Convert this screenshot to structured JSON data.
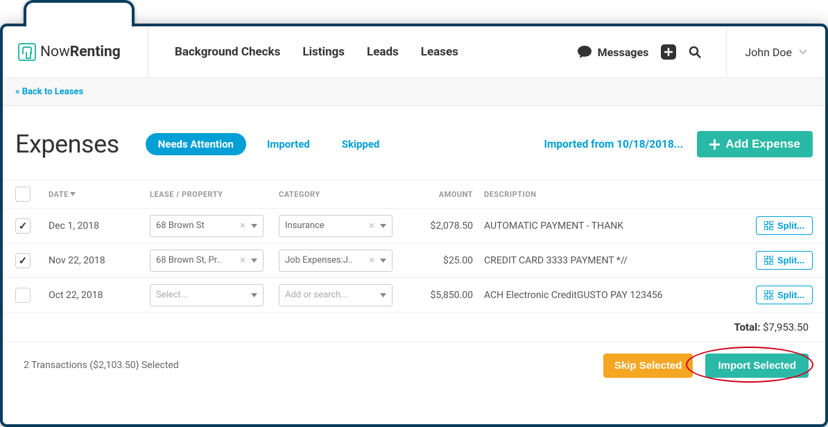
{
  "branding": {
    "name_part1": "Now",
    "name_part2": "Renting"
  },
  "nav": {
    "items": [
      "Background Checks",
      "Listings",
      "Leads",
      "Leases"
    ],
    "messages_label": "Messages",
    "user_name": "John Doe"
  },
  "subnav": {
    "back_link": "« Back to Leases"
  },
  "page": {
    "title": "Expenses",
    "tabs": {
      "active": "Needs Attention",
      "imported": "Imported",
      "skipped": "Skipped"
    },
    "imported_from": "Imported from 10/18/2018...",
    "add_expense": "Add Expense"
  },
  "table": {
    "headers": {
      "date": "DATE",
      "lease": "LEASE / PROPERTY",
      "category": "CATEGORY",
      "amount": "AMOUNT",
      "description": "DESCRIPTION"
    },
    "select_placeholder": "Select...",
    "category_placeholder": "Add or search...",
    "split_label": "Split...",
    "rows": [
      {
        "checked": true,
        "date": "Dec 1, 2018",
        "lease": "68 Brown St",
        "category": "Insurance",
        "amount": "$2,078.50",
        "description": "AUTOMATIC PAYMENT - THANK"
      },
      {
        "checked": true,
        "date": "Nov 22, 2018",
        "lease": "68 Brown St, Pr..",
        "category": "Job Expenses:J..",
        "amount": "$25.00",
        "description": "CREDIT CARD 3333 PAYMENT *//"
      },
      {
        "checked": false,
        "date": "Oct 22, 2018",
        "lease": "",
        "category": "",
        "amount": "$5,850.00",
        "description": "ACH Electronic CreditGUSTO PAY 123456"
      }
    ],
    "total_label": "Total:",
    "total_value": "$7,953.50"
  },
  "footer": {
    "selection_text": "2 Transactions ($2,103.50) Selected",
    "skip_label": "Skip Selected",
    "import_label": "Import Selected"
  }
}
